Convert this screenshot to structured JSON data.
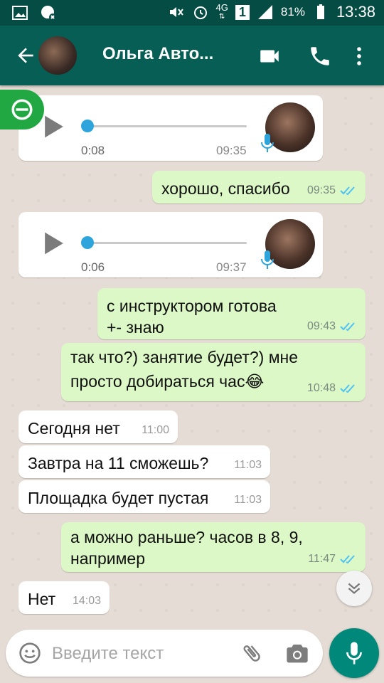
{
  "status_bar": {
    "network": "4G",
    "sim": "1",
    "battery": "81%",
    "time": "13:38"
  },
  "header": {
    "contact_name": "Ольга Авто..."
  },
  "messages": [
    {
      "type": "voice",
      "dir": "in",
      "duration": "0:08",
      "time": "09:35"
    },
    {
      "type": "text",
      "dir": "out",
      "text": "хорошо, спасибо",
      "time": "09:35"
    },
    {
      "type": "voice",
      "dir": "in",
      "duration": "0:06",
      "time": "09:37"
    },
    {
      "type": "text",
      "dir": "out",
      "lines": [
        "с инструктором готова",
        "+- знаю"
      ],
      "time": "09:43"
    },
    {
      "type": "text",
      "dir": "out",
      "lines": [
        "так что?) занятие будет?) мне",
        "просто добираться час😂"
      ],
      "time": "10:48"
    },
    {
      "type": "text",
      "dir": "in",
      "text": "Сегодня нет",
      "time": "11:00"
    },
    {
      "type": "text",
      "dir": "in",
      "text": "Завтра на 11 сможешь?",
      "time": "11:03"
    },
    {
      "type": "text",
      "dir": "in",
      "text": "Площадка будет пустая",
      "time": "11:03"
    },
    {
      "type": "text",
      "dir": "out",
      "lines": [
        "а можно раньше? часов в 8, 9,",
        "например"
      ],
      "time": "11:47"
    },
    {
      "type": "text",
      "dir": "in",
      "text": "Нет",
      "time": "14:03"
    }
  ],
  "input": {
    "placeholder": "Введите текст"
  },
  "colors": {
    "header": "#075e54",
    "status_bar": "#054d44",
    "outgoing_bubble": "#dcf8c6",
    "incoming_bubble": "#ffffff",
    "mic_button": "#00897b",
    "read_ticks": "#4fc3f7"
  },
  "icons": [
    "gallery-icon",
    "whatsapp-icon",
    "mute-icon",
    "alarm-icon",
    "signal-icon",
    "battery-icon",
    "back-arrow-icon",
    "video-call-icon",
    "phone-icon",
    "more-vert-icon",
    "play-icon",
    "mic-icon",
    "double-check-icon",
    "chevron-down-icon",
    "emoji-icon",
    "attach-icon",
    "camera-icon"
  ]
}
